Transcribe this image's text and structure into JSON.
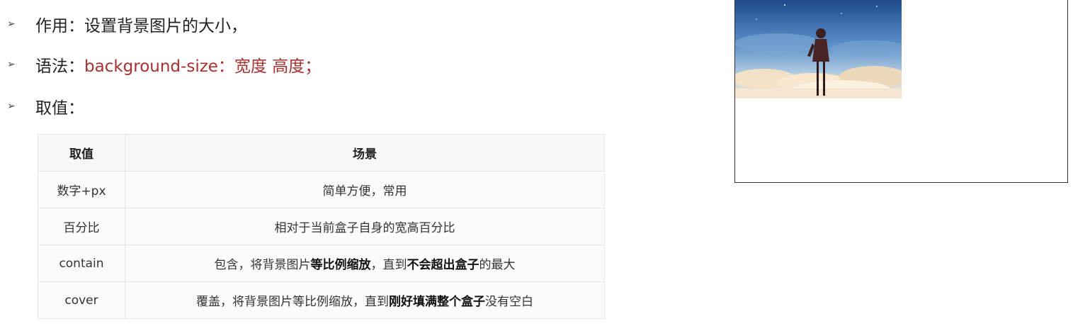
{
  "bullets": [
    {
      "arrow": "➢",
      "label": "作用：设置背景图片的大小，"
    },
    {
      "arrow": "➢",
      "label": "语法：",
      "code": "background-size：宽度 高度；"
    },
    {
      "arrow": "➢",
      "label": "取值："
    }
  ],
  "table": {
    "headers": [
      "取值",
      "场景"
    ],
    "rows": [
      {
        "value": "数字+px",
        "scene": [
          "简单方便，常用"
        ]
      },
      {
        "value": "百分比",
        "scene": [
          "相对于当前盒子自身的宽高百分比"
        ]
      },
      {
        "value": "contain",
        "scene": [
          "包含，将背景图片",
          "等比例缩放",
          "，直到",
          "不会超出盒子",
          "的最大"
        ]
      },
      {
        "value": "cover",
        "scene": [
          "覆盖，将背景图片等比例缩放，直到",
          "刚好填满整个盒子",
          "没有空白"
        ]
      }
    ]
  },
  "demo": {
    "image_description_icon": "anime-sky-girl-image",
    "colors": {
      "sky_top": "#1d4a8a",
      "sky_mid": "#6fa3d6",
      "cloud": "#f3e2c8",
      "figure": "#3a2020"
    }
  }
}
